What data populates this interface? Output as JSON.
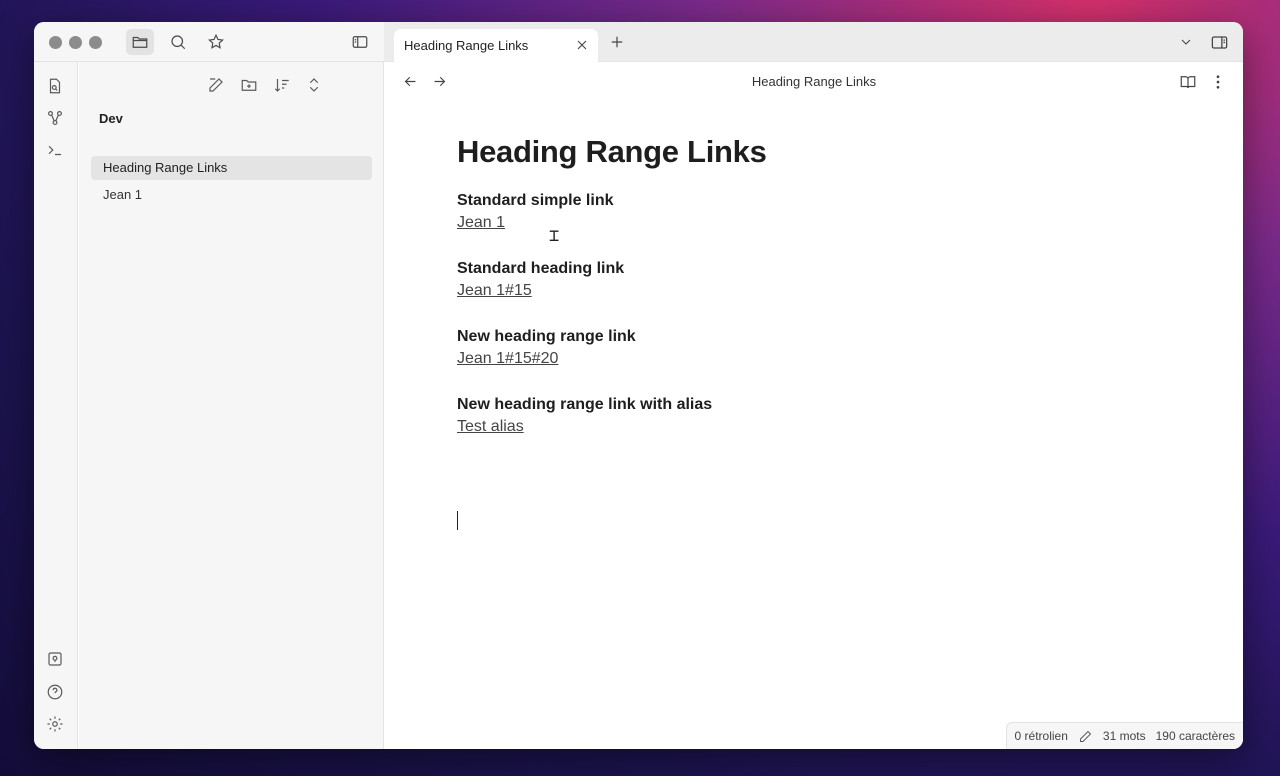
{
  "window": {
    "tab_title": "Heading Range Links",
    "nav_title": "Heading Range Links"
  },
  "explorer": {
    "folder": "Dev",
    "files": [
      {
        "label": "Heading Range Links",
        "active": true
      },
      {
        "label": "Jean 1",
        "active": false
      }
    ]
  },
  "document": {
    "title": "Heading Range Links",
    "sections": [
      {
        "heading": "Standard simple link",
        "link": "Jean 1"
      },
      {
        "heading": "Standard heading link",
        "link": "Jean 1#15"
      },
      {
        "heading": "New heading range link",
        "link": "Jean 1#15#20"
      },
      {
        "heading": "New heading range link with alias",
        "link": "Test alias"
      }
    ]
  },
  "status": {
    "backlinks": "0 rétrolien",
    "words": "31 mots",
    "chars": "190 caractères"
  },
  "colors": {
    "window_bg": "#ffffff",
    "sidebar_bg": "#f6f6f6",
    "tab_bar_bg": "#ececec",
    "active_item": "#e4e4e4"
  }
}
